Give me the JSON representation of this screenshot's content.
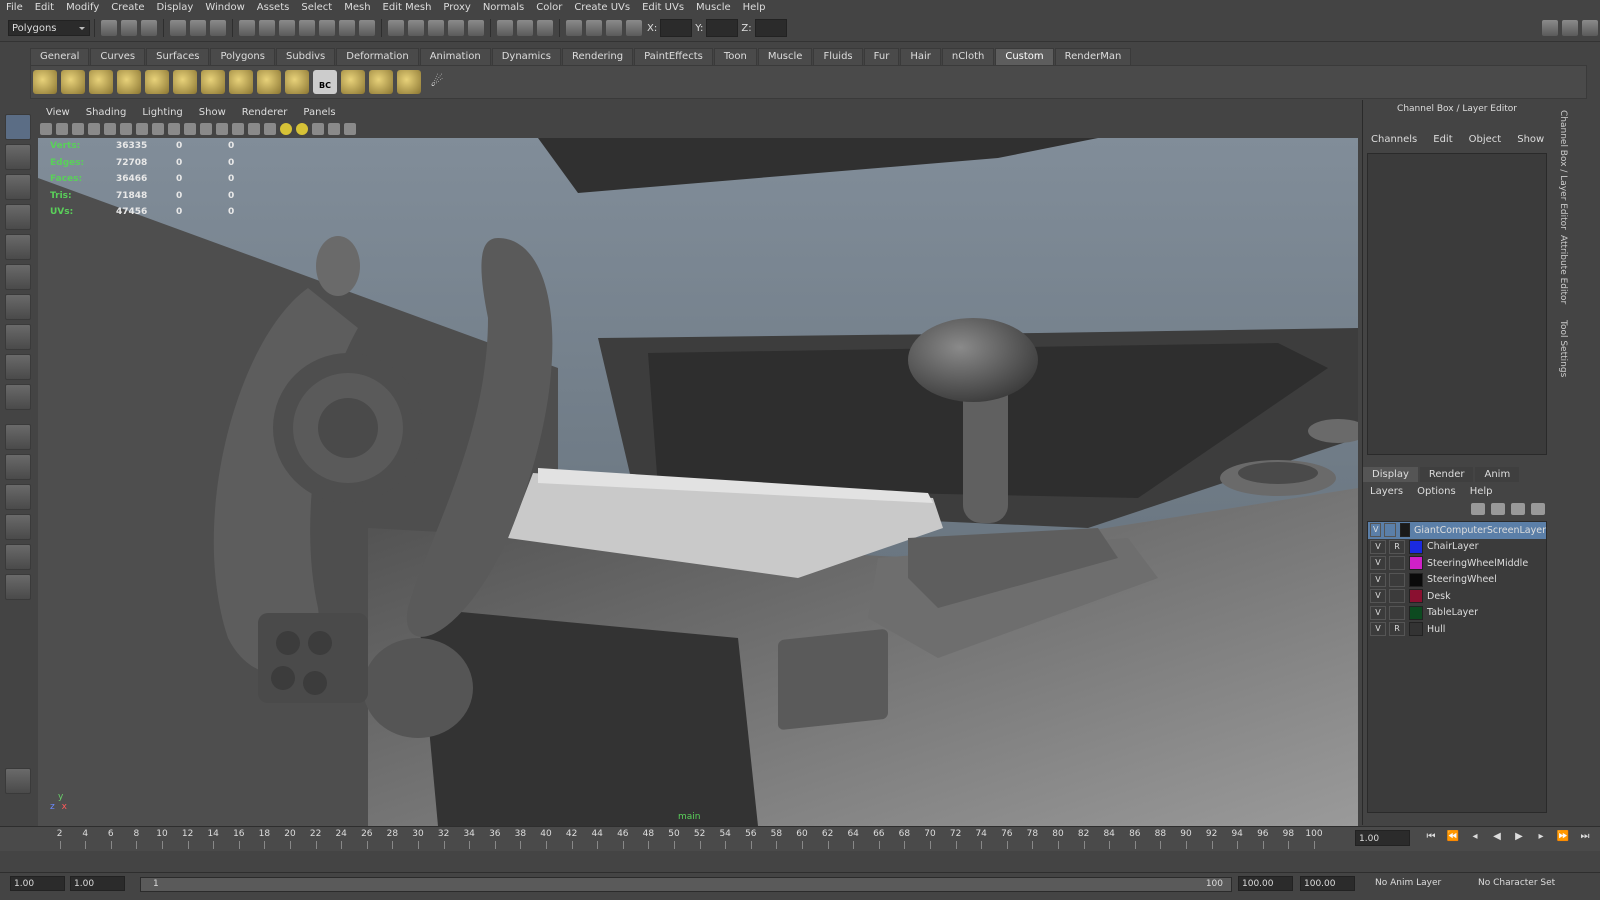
{
  "menu": [
    "File",
    "Edit",
    "Modify",
    "Create",
    "Display",
    "Window",
    "Assets",
    "Select",
    "Mesh",
    "Edit Mesh",
    "Proxy",
    "Normals",
    "Color",
    "Create UVs",
    "Edit UVs",
    "Muscle",
    "Help"
  ],
  "toolbar": {
    "mode": "Polygons",
    "x_label": "X:",
    "y_label": "Y:",
    "z_label": "Z:"
  },
  "shelf_tabs": [
    "General",
    "Curves",
    "Surfaces",
    "Polygons",
    "Subdivs",
    "Deformation",
    "Animation",
    "Dynamics",
    "Rendering",
    "PaintEffects",
    "Toon",
    "Muscle",
    "Fluids",
    "Fur",
    "Hair",
    "nCloth",
    "Custom",
    "RenderMan"
  ],
  "shelf_active": "Custom",
  "shelf_label_bc": "BC",
  "viewport_menu": [
    "View",
    "Shading",
    "Lighting",
    "Show",
    "Renderer",
    "Panels"
  ],
  "hud": [
    {
      "label": "Verts:",
      "a": "36335",
      "b": "0",
      "c": "0"
    },
    {
      "label": "Edges:",
      "a": "72708",
      "b": "0",
      "c": "0"
    },
    {
      "label": "Faces:",
      "a": "36466",
      "b": "0",
      "c": "0"
    },
    {
      "label": "Tris:",
      "a": "71848",
      "b": "0",
      "c": "0"
    },
    {
      "label": "UVs:",
      "a": "47456",
      "b": "0",
      "c": "0"
    }
  ],
  "camera_label": "main",
  "axis": {
    "y": "y",
    "z": "z",
    "x": "x"
  },
  "channel_box": {
    "title": "Channel Box / Layer Editor",
    "menu": [
      "Channels",
      "Edit",
      "Object",
      "Show"
    ],
    "layer_tabs": [
      "Display",
      "Render",
      "Anim"
    ],
    "layer_menu": [
      "Layers",
      "Options",
      "Help"
    ],
    "layers": [
      {
        "v": "V",
        "r": "",
        "color": "#1a1a1a",
        "name": "GiantComputerScreenLayer",
        "selected": true
      },
      {
        "v": "V",
        "r": "R",
        "color": "#1a2ae0",
        "name": "ChairLayer"
      },
      {
        "v": "V",
        "r": "",
        "color": "#d020c8",
        "name": "SteeringWheelMiddle"
      },
      {
        "v": "V",
        "r": "",
        "color": "#0a0a0a",
        "name": "SteeringWheel"
      },
      {
        "v": "V",
        "r": "",
        "color": "#8a1030",
        "name": "Desk"
      },
      {
        "v": "V",
        "r": "",
        "color": "#0d4a20",
        "name": "TableLayer"
      },
      {
        "v": "V",
        "r": "R",
        "color": "#333333",
        "name": "Hull"
      }
    ]
  },
  "side_labels": [
    "Channel Box / Layer Editor",
    "Attribute Editor",
    "Tool Settings"
  ],
  "timeline": {
    "ticks": [
      "2",
      "4",
      "6",
      "8",
      "10",
      "12",
      "14",
      "16",
      "18",
      "20",
      "22",
      "24",
      "26",
      "28",
      "30",
      "32",
      "34",
      "36",
      "38",
      "40",
      "42",
      "44",
      "46",
      "48",
      "50",
      "52",
      "54",
      "56",
      "58",
      "60",
      "62",
      "64",
      "66",
      "68",
      "70",
      "72",
      "74",
      "76",
      "78",
      "80",
      "82",
      "84",
      "86",
      "88",
      "90",
      "92",
      "94",
      "96",
      "98",
      "100"
    ],
    "current": "1.00"
  },
  "range": {
    "start": "1.00",
    "start2": "1.00",
    "slider_start": "1",
    "slider_end": "100",
    "end": "100.00",
    "end2": "100.00",
    "anim_layer": "No Anim Layer",
    "char_set": "No Character Set"
  }
}
